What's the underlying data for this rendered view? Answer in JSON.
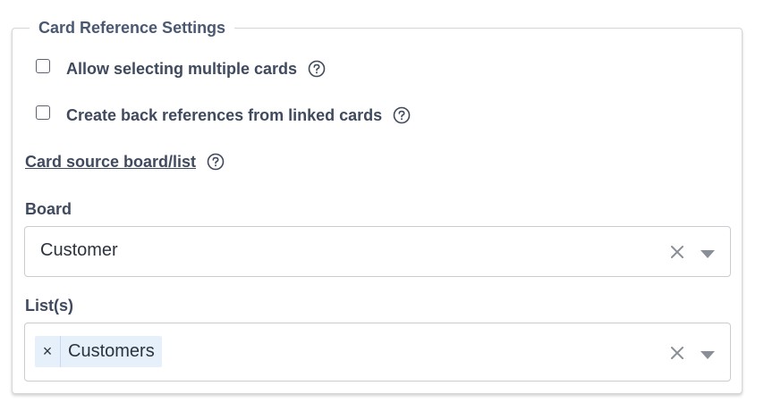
{
  "panel": {
    "title": "Card Reference Settings"
  },
  "options": {
    "multiple": {
      "label": "Allow selecting multiple cards",
      "checked": false
    },
    "backrefs": {
      "label": "Create back references from linked cards",
      "checked": false
    }
  },
  "source": {
    "link_label": "Card source board/list"
  },
  "board": {
    "label": "Board",
    "value": "Customer"
  },
  "lists": {
    "label": "List(s)",
    "tags": [
      {
        "label": "Customers",
        "remove": "×"
      }
    ]
  },
  "icons": {
    "help": "help-circle-icon",
    "clear": "close-icon",
    "dropdown": "chevron-down-icon"
  },
  "colors": {
    "label_text": "#404a5e",
    "tag_bg": "#e6f0fb",
    "border": "#c9ccd1"
  }
}
